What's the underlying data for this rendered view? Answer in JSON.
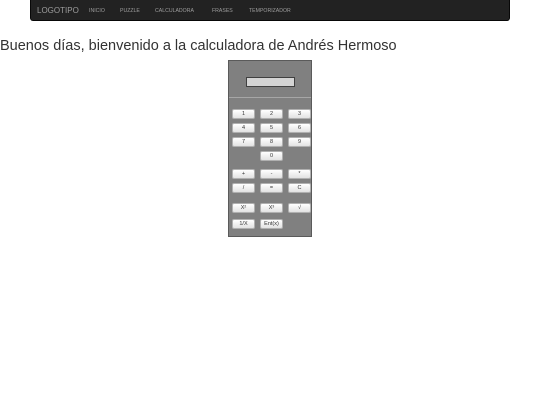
{
  "navbar": {
    "brand": "LOGOTIPO",
    "links": [
      "INICIO",
      "PUZZLE",
      "CALCULADORA",
      "FRASES",
      "TEMPORIZADOR"
    ]
  },
  "greeting": "Buenos días, bienvenido a la calculadora de Andrés Hermoso",
  "calculator": {
    "display_value": "",
    "digits": [
      "1",
      "2",
      "3",
      "4",
      "5",
      "6",
      "7",
      "8",
      "9",
      "0"
    ],
    "operators": [
      "+",
      "-",
      "*",
      "/",
      "=",
      "C"
    ],
    "functions": [
      "X²",
      "X³",
      "√",
      "1/X",
      "Ent(x)"
    ]
  },
  "colors": {
    "navbar_bg": "#222222",
    "navbar_text": "#9d9d9d",
    "calculator_body": "#808080",
    "display_bg": "#d4d4d4"
  }
}
